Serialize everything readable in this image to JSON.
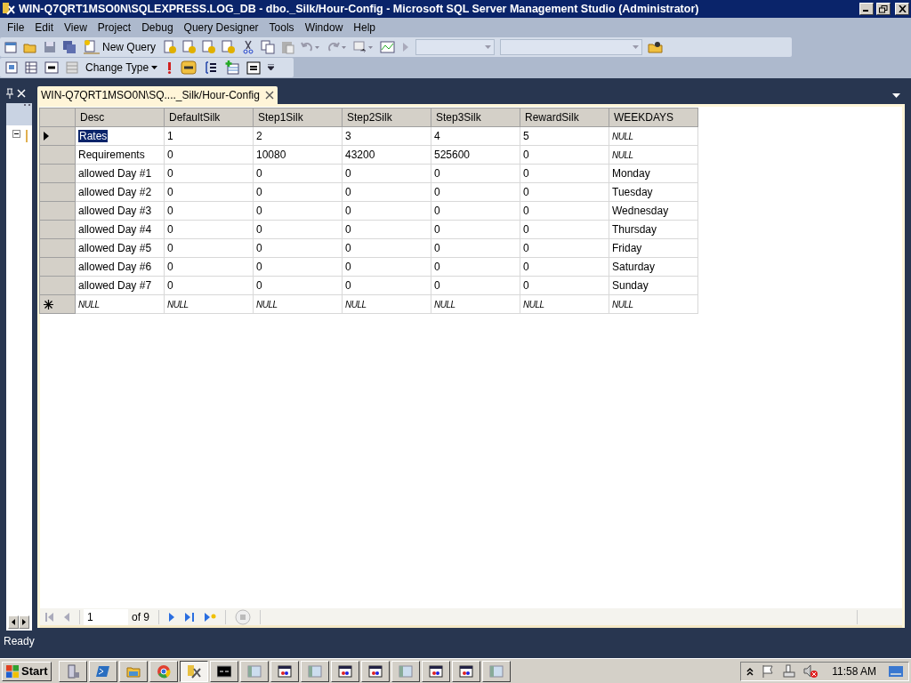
{
  "window": {
    "title": "WIN-Q7QRT1MSO0N\\SQLEXPRESS.LOG_DB - dbo._Silk/Hour-Config - Microsoft SQL Server Management Studio (Administrator)"
  },
  "menu": [
    "File",
    "Edit",
    "View",
    "Project",
    "Debug",
    "Query Designer",
    "Tools",
    "Window",
    "Help"
  ],
  "toolbar": {
    "new_query": "New Query",
    "change_type": "Change Type"
  },
  "tab": {
    "label": "WIN-Q7QRT1MSO0N\\SQ...._Silk/Hour-Config",
    "selected": true
  },
  "grid": {
    "columns": [
      "Desc",
      "DefaultSilk",
      "Step1Silk",
      "Step2Silk",
      "Step3Silk",
      "RewardSilk",
      "WEEKDAYS"
    ],
    "rows": [
      {
        "kind": "data",
        "current": true,
        "cells": [
          "Rates",
          "1",
          "2",
          "3",
          "4",
          "5",
          {
            "text": "NULL",
            "is_null": true
          }
        ]
      },
      {
        "kind": "data",
        "current": false,
        "cells": [
          "Requirements",
          "0",
          "10080",
          "43200",
          "525600",
          "0",
          {
            "text": "NULL",
            "is_null": true
          }
        ]
      },
      {
        "kind": "data",
        "current": false,
        "cells": [
          "allowed Day #1",
          "0",
          "0",
          "0",
          "0",
          "0",
          "Monday"
        ]
      },
      {
        "kind": "data",
        "current": false,
        "cells": [
          "allowed Day #2",
          "0",
          "0",
          "0",
          "0",
          "0",
          "Tuesday"
        ]
      },
      {
        "kind": "data",
        "current": false,
        "cells": [
          "allowed Day #3",
          "0",
          "0",
          "0",
          "0",
          "0",
          "Wednesday"
        ]
      },
      {
        "kind": "data",
        "current": false,
        "cells": [
          "allowed Day #4",
          "0",
          "0",
          "0",
          "0",
          "0",
          "Thursday"
        ]
      },
      {
        "kind": "data",
        "current": false,
        "cells": [
          "allowed Day #5",
          "0",
          "0",
          "0",
          "0",
          "0",
          "Friday"
        ]
      },
      {
        "kind": "data",
        "current": false,
        "cells": [
          "allowed Day #6",
          "0",
          "0",
          "0",
          "0",
          "0",
          "Saturday"
        ]
      },
      {
        "kind": "data",
        "current": false,
        "cells": [
          "allowed Day #7",
          "0",
          "0",
          "0",
          "0",
          "0",
          "Sunday"
        ]
      },
      {
        "kind": "new",
        "current": false,
        "cells": [
          {
            "text": "NULL",
            "is_null": true
          },
          {
            "text": "NULL",
            "is_null": true
          },
          {
            "text": "NULL",
            "is_null": true
          },
          {
            "text": "NULL",
            "is_null": true
          },
          {
            "text": "NULL",
            "is_null": true
          },
          {
            "text": "NULL",
            "is_null": true
          },
          {
            "text": "NULL",
            "is_null": true
          }
        ]
      }
    ]
  },
  "navigator": {
    "record": "1",
    "of": "of 9"
  },
  "status_bar": {
    "text": "Ready"
  },
  "taskbar": {
    "start": "Start",
    "clock": "11:58 AM",
    "items": [
      {
        "kind": "server",
        "active": false
      },
      {
        "kind": "powershell",
        "active": false
      },
      {
        "kind": "folder",
        "active": false
      },
      {
        "kind": "chrome",
        "active": false
      },
      {
        "kind": "ssms",
        "active": true
      },
      {
        "kind": "cmd",
        "active": false
      },
      {
        "kind": "window",
        "active": false
      },
      {
        "kind": "app",
        "active": false
      },
      {
        "kind": "window",
        "active": false
      },
      {
        "kind": "app",
        "active": false
      },
      {
        "kind": "app",
        "active": false
      },
      {
        "kind": "window",
        "active": false
      },
      {
        "kind": "app",
        "active": false
      },
      {
        "kind": "app",
        "active": false
      },
      {
        "kind": "window",
        "active": false
      }
    ]
  }
}
